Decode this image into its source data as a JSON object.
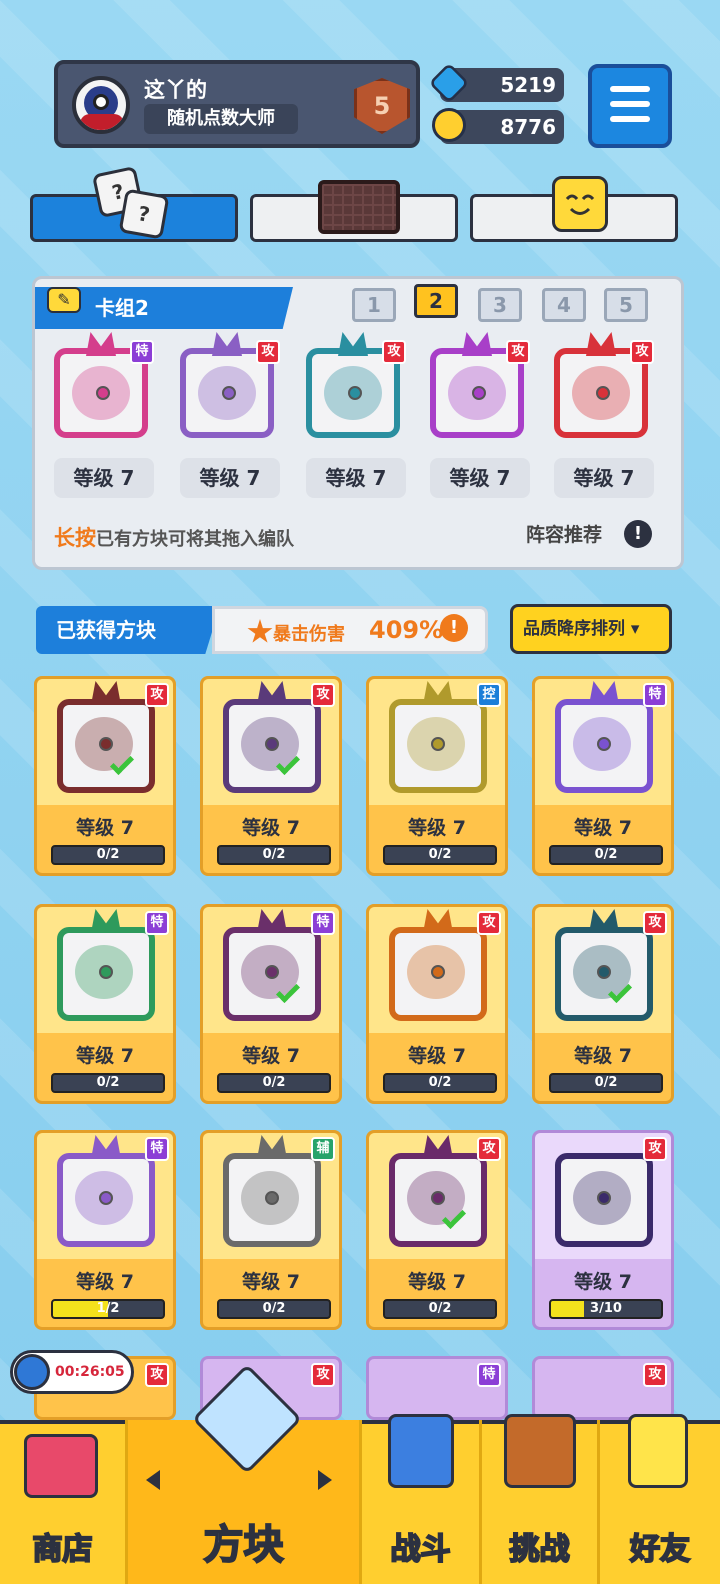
{
  "player": {
    "name": "这丫的",
    "title": "随机点数大师",
    "rank": "5"
  },
  "currency": {
    "gems": "5219",
    "coins": "8776"
  },
  "deck": {
    "title": "卡组2",
    "tabs": [
      "1",
      "2",
      "3",
      "4",
      "5"
    ],
    "selected_tab": "2",
    "cards": [
      {
        "tag": "特",
        "level": "等级 7",
        "color": "#d43e8c"
      },
      {
        "tag": "攻",
        "level": "等级 7",
        "color": "#8a5fc4"
      },
      {
        "tag": "攻",
        "level": "等级 7",
        "color": "#2a8fa0"
      },
      {
        "tag": "攻",
        "level": "等级 7",
        "color": "#a83fc8"
      },
      {
        "tag": "攻",
        "level": "等级 7",
        "color": "#d8323a"
      }
    ],
    "hint_highlight": "长按",
    "hint_text": "已有方块可将其拖入编队",
    "recommend": "阵容推荐",
    "info_mark": "!"
  },
  "owned": {
    "title": "已获得方块",
    "crit_label": "暴击伤害",
    "crit_value": "409%",
    "info_mark": "!",
    "sort_label": "品质降序排列 ▾",
    "cards": [
      {
        "tag": "攻",
        "level": "等级 7",
        "progress": "0/2",
        "fill": 0,
        "color": "#7a2d2d",
        "checked": true
      },
      {
        "tag": "攻",
        "level": "等级 7",
        "progress": "0/2",
        "fill": 0,
        "color": "#5a3a7a",
        "checked": true
      },
      {
        "tag": "控",
        "level": "等级 7",
        "progress": "0/2",
        "fill": 0,
        "color": "#b09a2c",
        "checked": false
      },
      {
        "tag": "特",
        "level": "等级 7",
        "progress": "0/2",
        "fill": 0,
        "color": "#7a52d0",
        "checked": false
      },
      {
        "tag": "特",
        "level": "等级 7",
        "progress": "0/2",
        "fill": 0,
        "color": "#2e9a5c",
        "checked": false
      },
      {
        "tag": "特",
        "level": "等级 7",
        "progress": "0/2",
        "fill": 0,
        "color": "#6a2f6a",
        "checked": true
      },
      {
        "tag": "攻",
        "level": "等级 7",
        "progress": "0/2",
        "fill": 0,
        "color": "#d26a1a",
        "checked": false
      },
      {
        "tag": "攻",
        "level": "等级 7",
        "progress": "0/2",
        "fill": 0,
        "color": "#235a6a",
        "checked": true
      },
      {
        "tag": "特",
        "level": "等级 7",
        "progress": "1/2",
        "fill": 0.5,
        "color": "#8a5ac8",
        "checked": false
      },
      {
        "tag": "辅",
        "level": "等级 7",
        "progress": "0/2",
        "fill": 0,
        "color": "#6a6a6a",
        "checked": false
      },
      {
        "tag": "攻",
        "level": "等级 7",
        "progress": "0/2",
        "fill": 0,
        "color": "#6a2a6a",
        "checked": true
      },
      {
        "tag": "攻",
        "level": "等级 7",
        "progress": "3/10",
        "fill": 0.3,
        "color": "#3a2a6a",
        "checked": false,
        "purple": true
      }
    ],
    "partial_tags": [
      "攻",
      "攻",
      "特",
      "攻"
    ]
  },
  "timer": "00:26:05",
  "nav": {
    "shop": "商店",
    "blocks": "方块",
    "battle": "战斗",
    "challenge": "挑战",
    "friends": "好友"
  }
}
